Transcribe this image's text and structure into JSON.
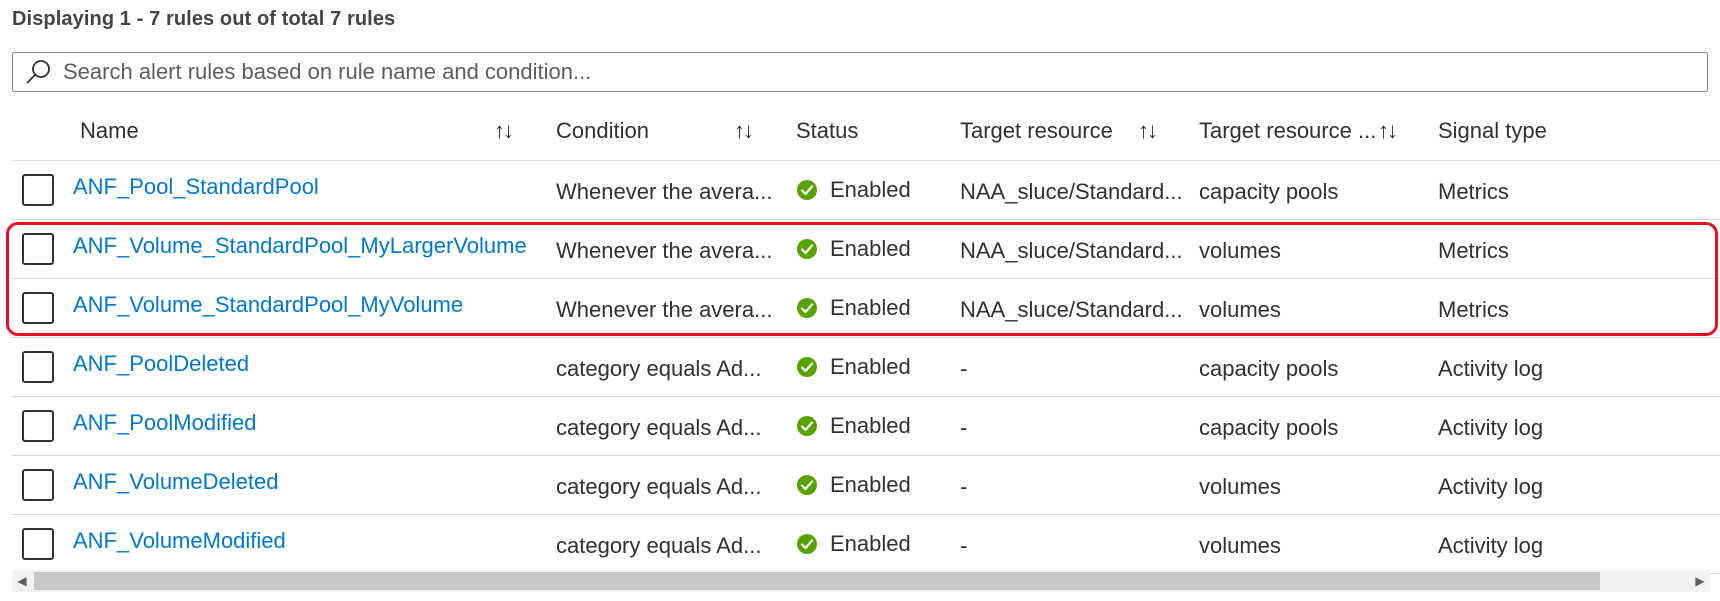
{
  "summary": "Displaying 1 - 7 rules out of total 7 rules",
  "search": {
    "placeholder": "Search alert rules based on rule name and condition...",
    "value": "",
    "icon": "search-icon"
  },
  "columns": {
    "name": "Name",
    "condition": "Condition",
    "status": "Status",
    "target": "Target resource",
    "target_type": "Target resource ...",
    "signal": "Signal type",
    "sort_glyph": "↑↓"
  },
  "rows": [
    {
      "name": "ANF_Pool_StandardPool",
      "condition": "Whenever the avera...",
      "status": "Enabled",
      "target": "NAA_sluce/Standard...",
      "target_type": "capacity pools",
      "signal": "Metrics"
    },
    {
      "name": "ANF_Volume_StandardPool_MyLargerVolume",
      "condition": "Whenever the avera...",
      "status": "Enabled",
      "target": "NAA_sluce/Standard...",
      "target_type": "volumes",
      "signal": "Metrics"
    },
    {
      "name": "ANF_Volume_StandardPool_MyVolume",
      "condition": "Whenever the avera...",
      "status": "Enabled",
      "target": "NAA_sluce/Standard...",
      "target_type": "volumes",
      "signal": "Metrics"
    },
    {
      "name": "ANF_PoolDeleted",
      "condition": "category equals Ad...",
      "status": "Enabled",
      "target": "-",
      "target_type": "capacity pools",
      "signal": "Activity log"
    },
    {
      "name": "ANF_PoolModified",
      "condition": "category equals Ad...",
      "status": "Enabled",
      "target": "-",
      "target_type": "capacity pools",
      "signal": "Activity log"
    },
    {
      "name": "ANF_VolumeDeleted",
      "condition": "category equals Ad...",
      "status": "Enabled",
      "target": "-",
      "target_type": "volumes",
      "signal": "Activity log"
    },
    {
      "name": "ANF_VolumeModified",
      "condition": "category equals Ad...",
      "status": "Enabled",
      "target": "-",
      "target_type": "volumes",
      "signal": "Activity log"
    }
  ],
  "colors": {
    "link": "#0078d4",
    "status_ok": "#57a300",
    "highlight": "#e81123"
  },
  "scrollbar": {
    "left_arrow": "◀",
    "right_arrow": "▶"
  }
}
